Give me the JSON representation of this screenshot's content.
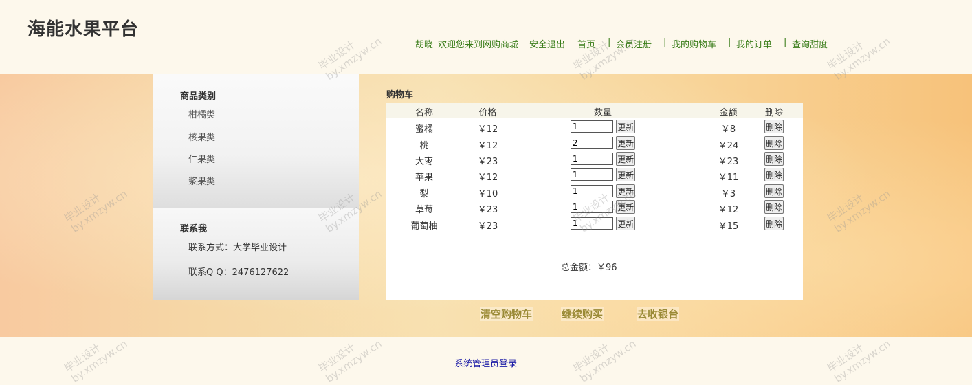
{
  "header": {
    "site_title": "海能水果平台",
    "user_name": "胡晓",
    "welcome": "欢迎您来到网购商城",
    "logout": "安全退出",
    "nav": [
      "首页",
      "会员注册",
      "我的购物车",
      "我的订单",
      "查询甜度"
    ],
    "separator": "|"
  },
  "sidebar": {
    "category_heading": "商品类别",
    "categories": [
      "柑橘类",
      "核果类",
      "仁果类",
      "浆果类"
    ],
    "contact_heading": "联系我",
    "contact_method": "联系方式：大学毕业设计",
    "contact_qq": "联系Q Q：2476127622"
  },
  "cart": {
    "title": "购物车",
    "columns": [
      "名称",
      "价格",
      "数量",
      "金额",
      "删除"
    ],
    "update_label": "更新",
    "delete_label": "删除",
    "rows": [
      {
        "name": "蜜橘",
        "price": "￥12",
        "qty": "1",
        "amount": "￥8"
      },
      {
        "name": "桃",
        "price": "￥12",
        "qty": "2",
        "amount": "￥24"
      },
      {
        "name": "大枣",
        "price": "￥23",
        "qty": "1",
        "amount": "￥23"
      },
      {
        "name": "苹果",
        "price": "￥12",
        "qty": "1",
        "amount": "￥11"
      },
      {
        "name": "梨",
        "price": "￥10",
        "qty": "1",
        "amount": "￥3"
      },
      {
        "name": "草莓",
        "price": "￥23",
        "qty": "1",
        "amount": "￥12"
      },
      {
        "name": "葡萄柚",
        "price": "￥23",
        "qty": "1",
        "amount": "￥15"
      }
    ],
    "total_label": "总金额：",
    "total_value": "￥96"
  },
  "actions": {
    "clear": "清空购物车",
    "continue": "继续购买",
    "checkout": "去收银台"
  },
  "footer": {
    "admin_login": "系统管理员登录"
  },
  "watermark": {
    "line1": "毕业设计",
    "line2": "by.xmzyw.cn"
  }
}
